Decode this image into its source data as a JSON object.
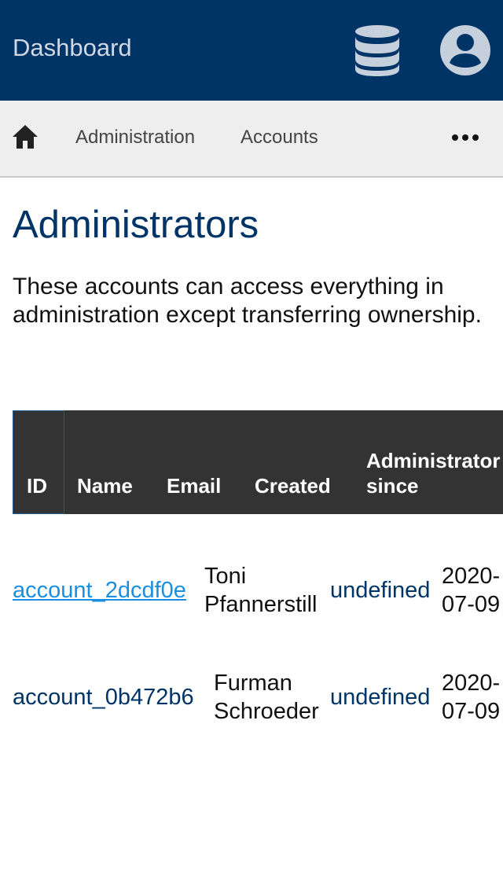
{
  "header": {
    "title": "Dashboard",
    "database_icon": "database-icon",
    "account_icon": "account-circle-icon",
    "background_color": "#003366"
  },
  "breadcrumb": {
    "home_icon": "home-icon",
    "items": [
      "Administration",
      "Accounts"
    ],
    "more_icon": "more-horizontal-icon"
  },
  "page": {
    "title": "Administrators",
    "description": "These accounts can access everything in administration except transferring ownership."
  },
  "table": {
    "columns": [
      "ID",
      "Name",
      "Email",
      "Created",
      "Administrator since"
    ],
    "rows": [
      {
        "id": "account_2dcdf0e",
        "name_line1": "Toni",
        "name_line2": "Pfannerstill",
        "email": "undefined",
        "created_line1": "2020-",
        "created_line2": "07-09"
      },
      {
        "id": "account_0b472b6",
        "name_line1": "Furman",
        "name_line2": "Schroeder",
        "email": "undefined",
        "created_line1": "2020-",
        "created_line2": "07-09"
      }
    ]
  },
  "colors": {
    "primary": "#003366",
    "link": "#1a8fe0",
    "table_header": "#333333"
  }
}
